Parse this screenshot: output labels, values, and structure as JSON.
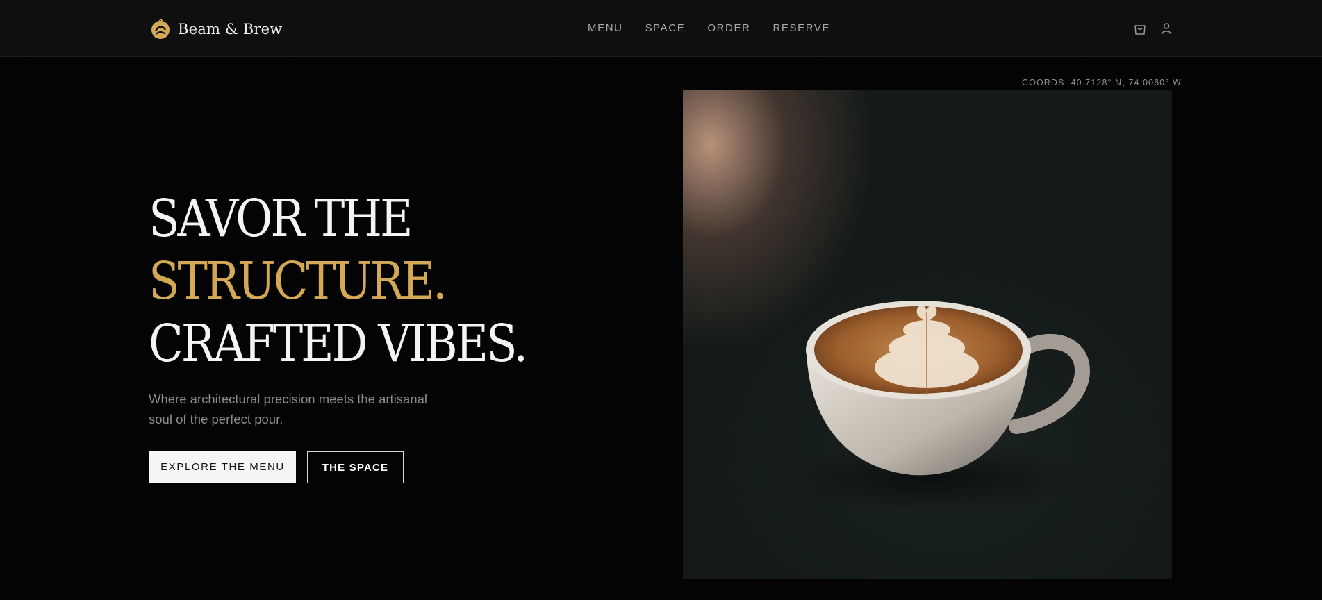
{
  "header": {
    "brand_name": "Beam & Brew",
    "nav": [
      {
        "label": "MENU"
      },
      {
        "label": "SPACE"
      },
      {
        "label": "ORDER"
      },
      {
        "label": "RESERVE"
      }
    ],
    "icons": [
      "bag-icon",
      "user-icon"
    ]
  },
  "hero": {
    "headline_line1": "SAVOR THE",
    "headline_line2": "STRUCTURE.",
    "headline_line3": "CRAFTED VIBES.",
    "subtitle": "Where architectural precision meets the artisanal soul of the perfect pour.",
    "primary_button": "EXPLORE THE MENU",
    "secondary_button": "THE SPACE",
    "coords": "COORDS: 40.7128° N, 74.0060° W"
  },
  "colors": {
    "accent": "#d4a955",
    "background": "#040404",
    "header_background": "#0f0f0f",
    "text_primary": "#f4f4f4",
    "text_muted": "#8c8c8c"
  }
}
